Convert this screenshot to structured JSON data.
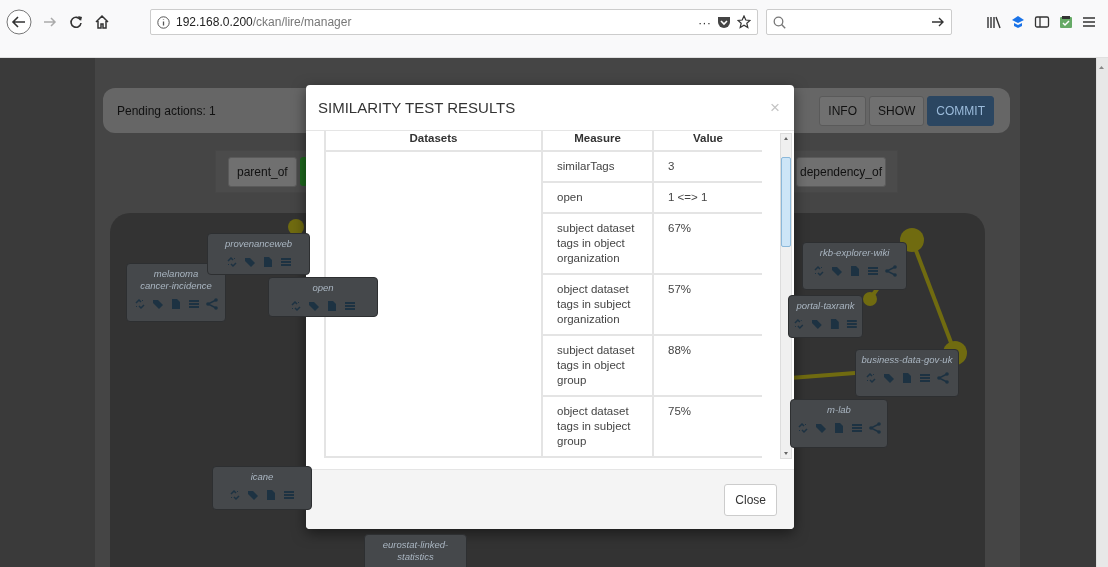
{
  "browser": {
    "url_host": "192.168.0.200",
    "url_path": "/ckan/lire/manager",
    "more_symbol": "···",
    "forward_disabled": true
  },
  "page": {
    "pending_label": "Pending actions: 1",
    "actions": [
      {
        "label": "INFO",
        "kind": "default"
      },
      {
        "label": "SHOW",
        "kind": "default"
      },
      {
        "label": "COMMIT",
        "kind": "primary"
      }
    ],
    "relation_buttons": [
      {
        "kind": "default",
        "label": "parent_of"
      },
      {
        "kind": "success"
      },
      {
        "kind": "default",
        "label": "dependency_of"
      }
    ],
    "nodes": [
      {
        "lines": [
          "melanoma",
          "cancer-incidence"
        ],
        "kind": "full"
      },
      {
        "lines": [
          "provenanceweb"
        ],
        "kind": "basic"
      },
      {
        "lines": [
          "open"
        ],
        "kind": "basic"
      },
      {
        "lines": [
          "icane"
        ],
        "kind": "basic"
      },
      {
        "lines": [
          "eurostat-linked-",
          "statistics"
        ],
        "kind": "label"
      },
      {
        "lines": [
          "rkb-explorer-wiki"
        ],
        "kind": "full"
      },
      {
        "lines": [
          "portal-taxrank"
        ],
        "kind": "basic"
      },
      {
        "lines": [
          "business-data-gov-uk"
        ],
        "kind": "full"
      },
      {
        "lines": [
          "m-lab"
        ],
        "kind": "full"
      }
    ]
  },
  "modal": {
    "title": "SIMILARITY TEST RESULTS",
    "close_symbol": "×",
    "columns": [
      "Datasets",
      "Measure",
      "Value"
    ],
    "rows": [
      {
        "measure": "similarTags",
        "value": "3"
      },
      {
        "measure": "open",
        "value": "1 <=> 1"
      },
      {
        "measure": "subject dataset tags in object organization",
        "value": "67%"
      },
      {
        "measure": "object dataset tags in subject organization",
        "value": "57%"
      },
      {
        "measure": "subject dataset tags in object group",
        "value": "88%"
      },
      {
        "measure": "object dataset tags in subject group",
        "value": "75%"
      }
    ],
    "close_button": "Close"
  }
}
